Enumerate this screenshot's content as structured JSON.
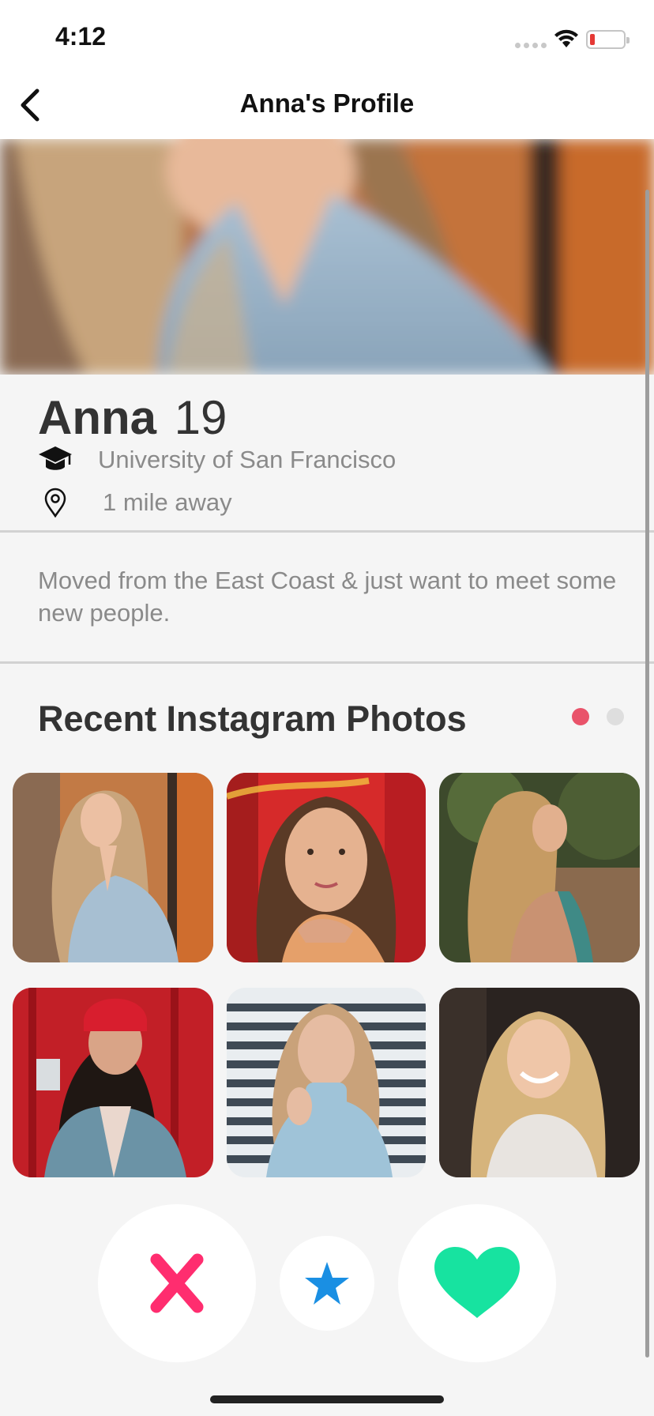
{
  "status_bar": {
    "time": "4:12",
    "icons": [
      "signal-icon",
      "wifi-icon",
      "battery-icon"
    ]
  },
  "nav": {
    "title": "Anna's Profile",
    "back_icon": "chevron-left-icon"
  },
  "profile": {
    "name": "Anna",
    "age": "19",
    "school": "University of San Francisco",
    "distance": "1 mile away",
    "bio": "Moved from the East Coast & just want to meet some new people."
  },
  "instagram": {
    "title": "Recent Instagram Photos",
    "page_count": 2,
    "active_page": 1,
    "photos": [
      "photo-1",
      "photo-2",
      "photo-3",
      "photo-4",
      "photo-5",
      "photo-6"
    ]
  },
  "actions": {
    "nope_icon": "x-icon",
    "super_like_icon": "star-icon",
    "like_icon": "heart-icon"
  },
  "colors": {
    "accent_pink": "#ff2d6f",
    "star_blue": "#1a8fe3",
    "like_green": "#17e3a0",
    "dot_active": "#e9536a",
    "dot_inactive": "#dedede",
    "text_dark": "#333333",
    "text_muted": "#8a8a8a"
  }
}
